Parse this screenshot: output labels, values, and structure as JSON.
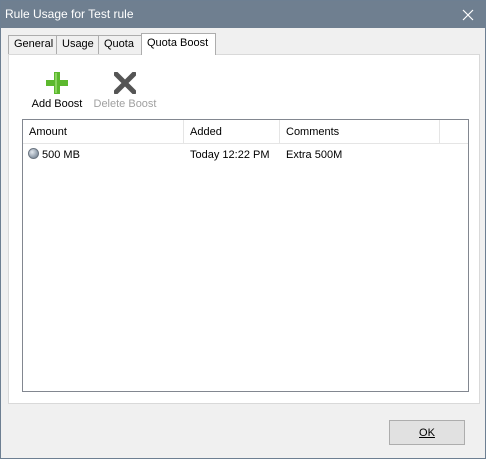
{
  "window": {
    "title": "Rule Usage for Test rule",
    "close_icon": "close-icon"
  },
  "tabs": [
    {
      "label": "General",
      "active": false
    },
    {
      "label": "Usage",
      "active": false
    },
    {
      "label": "Quota",
      "active": false
    },
    {
      "label": "Quota Boost",
      "active": true
    }
  ],
  "toolbar": {
    "add_label": "Add Boost",
    "add_icon": "plus-icon",
    "add_color": "#5cb82e",
    "delete_label": "Delete Boost",
    "delete_icon": "x-icon",
    "delete_enabled": false
  },
  "table": {
    "columns": [
      "Amount",
      "Added",
      "Comments"
    ],
    "rows": [
      {
        "amount": "500 MB",
        "added": "Today 12:22 PM",
        "comments": "Extra 500M",
        "status_icon": "gray-circle-icon"
      }
    ]
  },
  "footer": {
    "ok_label": "OK"
  }
}
